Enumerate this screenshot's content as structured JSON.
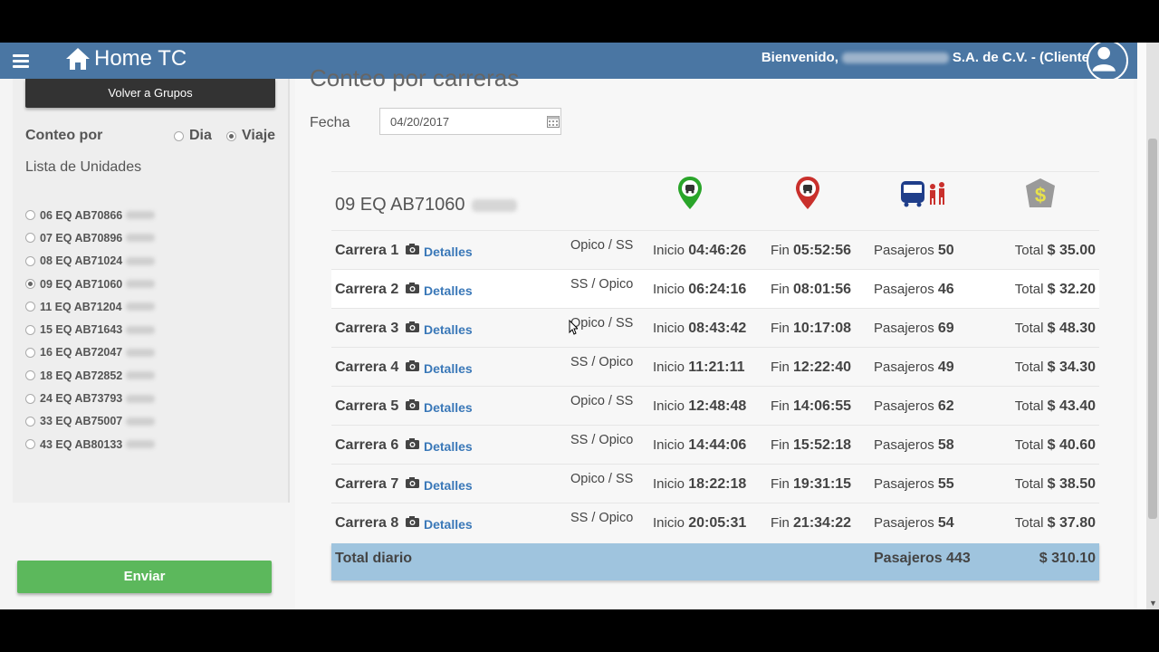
{
  "navbar": {
    "brand": "Home TC",
    "welcome_prefix": "Bienvenido,",
    "welcome_suffix": "S.A. de C.V. - (Cliente)"
  },
  "sidebar": {
    "back_button": "Volver a Grupos",
    "conteo_label": "Conteo por",
    "options": [
      "Dia",
      "Viaje"
    ],
    "selected_option": "Viaje",
    "lista_label": "Lista de Unidades",
    "units": [
      "06 EQ AB70866",
      "07 EQ AB70896",
      "08 EQ AB71024",
      "09 EQ AB71060",
      "11 EQ AB71204",
      "15 EQ AB71643",
      "16 EQ AB72047",
      "18 EQ AB72852",
      "24 EQ AB73793",
      "33 EQ AB75007",
      "43 EQ AB80133"
    ],
    "selected_unit": "09 EQ AB71060",
    "submit_button": "Enviar"
  },
  "main": {
    "title": "Conteo por carreras",
    "fecha_label": "Fecha",
    "fecha_value": "04/20/2017",
    "unit_title": "09 EQ AB71060",
    "header_icons": [
      "start-location-icon",
      "end-location-icon",
      "bus-passengers-icon",
      "money-icon"
    ],
    "colors": {
      "start": "#2aa52a",
      "end": "#c9302c",
      "bus": "#1f3e8a",
      "money": "#e8e24a"
    },
    "link_label": "Detalles",
    "labels": {
      "inicio": "Inicio",
      "fin": "Fin",
      "pasajeros": "Pasajeros",
      "total": "Total"
    },
    "rows": [
      {
        "name": "Carrera 1",
        "route": "Opico / SS",
        "inicio": "04:46:26",
        "fin": "05:52:56",
        "pasajeros": "50",
        "total": "$ 35.00"
      },
      {
        "name": "Carrera 2",
        "route": "SS / Opico",
        "inicio": "06:24:16",
        "fin": "08:01:56",
        "pasajeros": "46",
        "total": "$ 32.20"
      },
      {
        "name": "Carrera 3",
        "route": "Opico / SS",
        "inicio": "08:43:42",
        "fin": "10:17:08",
        "pasajeros": "69",
        "total": "$ 48.30"
      },
      {
        "name": "Carrera 4",
        "route": "SS / Opico",
        "inicio": "11:21:11",
        "fin": "12:22:40",
        "pasajeros": "49",
        "total": "$ 34.30"
      },
      {
        "name": "Carrera 5",
        "route": "Opico / SS",
        "inicio": "12:48:48",
        "fin": "14:06:55",
        "pasajeros": "62",
        "total": "$ 43.40"
      },
      {
        "name": "Carrera 6",
        "route": "SS / Opico",
        "inicio": "14:44:06",
        "fin": "15:52:18",
        "pasajeros": "58",
        "total": "$ 40.60"
      },
      {
        "name": "Carrera 7",
        "route": "Opico / SS",
        "inicio": "18:22:18",
        "fin": "19:31:15",
        "pasajeros": "55",
        "total": "$ 38.50"
      },
      {
        "name": "Carrera 8",
        "route": "SS / Opico",
        "inicio": "20:05:31",
        "fin": "21:34:22",
        "pasajeros": "54",
        "total": "$ 37.80"
      }
    ],
    "total_row": {
      "label": "Total diario",
      "pasajeros": "Pasajeros 443",
      "total": "$ 310.10"
    }
  }
}
